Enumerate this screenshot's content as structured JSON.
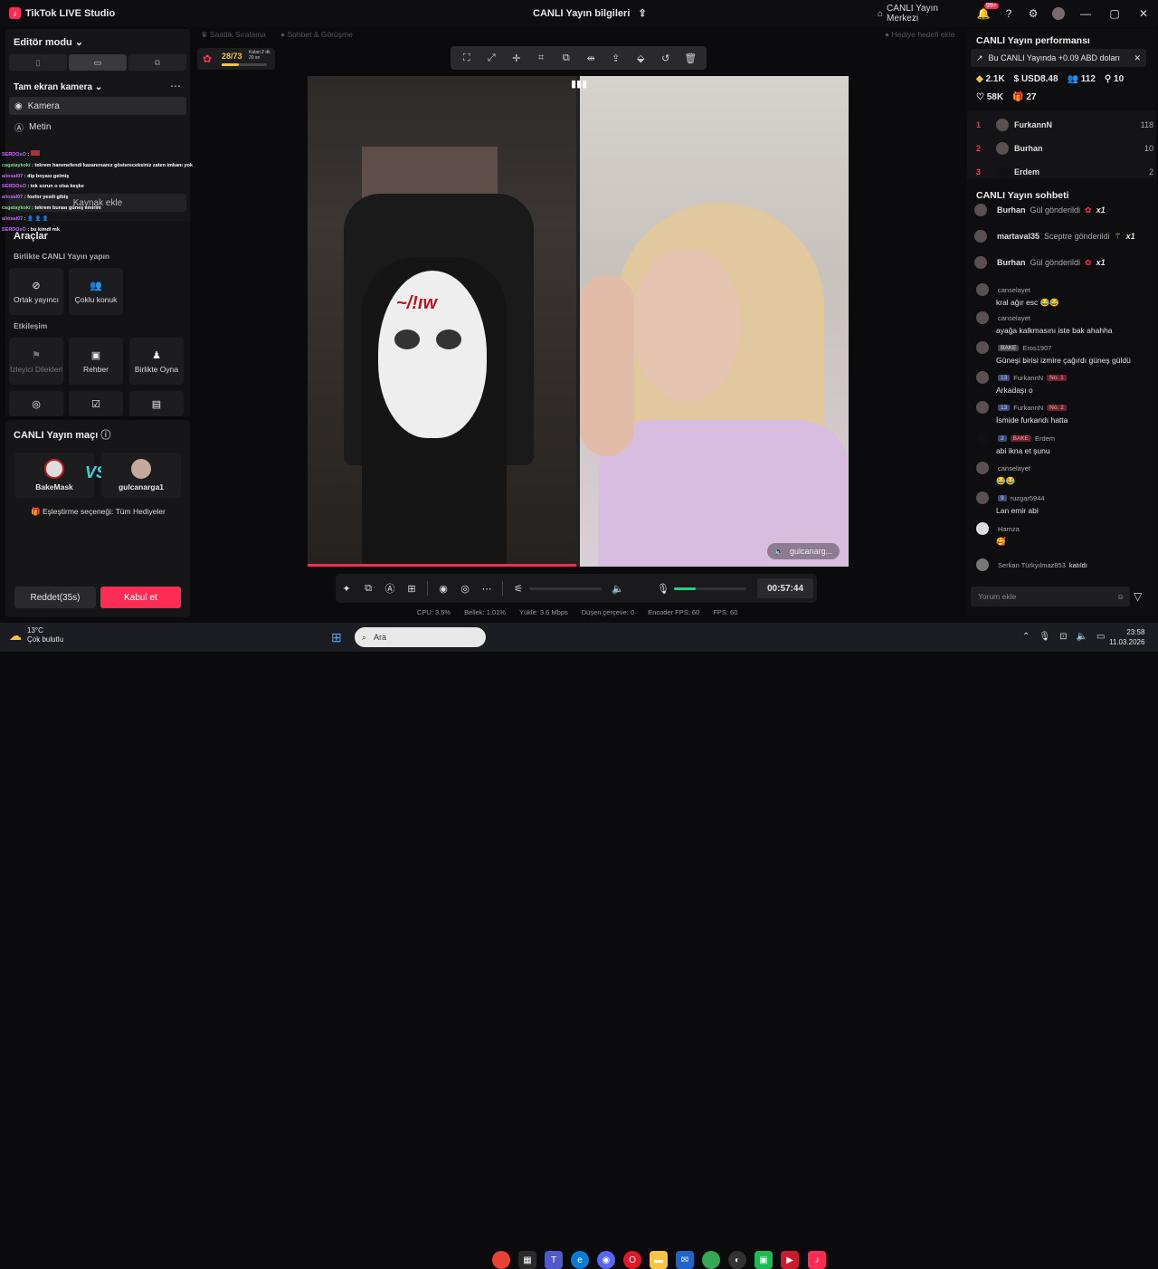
{
  "window": {
    "app_title": "TikTok LIVE Studio",
    "center_title": "CANLI Yayın bilgileri",
    "live_center": "CANLI Yayın Merkezi",
    "notif_count": "99+"
  },
  "left": {
    "editor_mode": "Editör modu",
    "fullscreen_camera": "Tam ekran kamera",
    "sources": [
      {
        "label": "Kamera"
      },
      {
        "label": "Metin"
      }
    ],
    "add_source": "Kaynak ekle",
    "tools_title": "Araçlar",
    "live_together_title": "Birlikte CANLI Yayın yapın",
    "live_together_tools": [
      {
        "label": "Ortak yayıncı"
      },
      {
        "label": "Çoklu konuk"
      }
    ],
    "interaction_title": "Etkileşim",
    "interaction_tools": [
      {
        "label": "İzleyici Dilekleri"
      },
      {
        "label": "Rehber"
      },
      {
        "label": "Birlikte Oyna"
      }
    ],
    "match_title": "CANLI Yayın maçı",
    "player1": "BakeMask",
    "player2": "gulcanarga1",
    "match_option": "Eşleştirme seçeneği: Tüm Hediyeler",
    "decline": "Reddet(35s)",
    "accept": "Kabul et"
  },
  "overlay_chat": [
    {
      "user": "SERDOsO",
      "msg": ""
    },
    {
      "user": "cagataykoki",
      "msg": "tekrem hanımefendi kazanırsanız göstereceksiniz zaten imkanı yok"
    },
    {
      "user": "aliosal07",
      "msg": "dip boyası gelmiş"
    },
    {
      "user": "SERDOsO",
      "msg": "tek sorun o olsa keşke"
    },
    {
      "user": "aliosal07",
      "msg": "fosfor yesili gibiş"
    },
    {
      "user": "cagataykoki",
      "msg": "tekrem burası güneş emirim"
    },
    {
      "user": "aliosal07",
      "msg": ""
    },
    {
      "user": "SERDOsO",
      "msg": "bu kimdi mk"
    }
  ],
  "top_widgets": {
    "left_hint": "Saatlik Sıralama",
    "mid_hint": "Sohbet & Görüşme",
    "right_hint": "Hediye hedefi ekle",
    "goal": "28/73",
    "goal_time": "Kalan 2 dk 20 sn"
  },
  "stage": {
    "guest_label": "gulcanarg..."
  },
  "bottom": {
    "timer": "00:57:44",
    "cpu": "CPU: 3.5%",
    "memory": "Bellek: 1.01%",
    "upload": "Yükle: 3.6 Mbps",
    "dropped": "Düşen çerçeve: 0",
    "encoder_fps": "Encoder FPS: 60",
    "fps": "FPS: 60",
    "mic_level": 0.3
  },
  "right": {
    "perf_title": "CANLI Yayın performansı",
    "perf_banner": "Bu CANLI Yayında +0.09 ABD doları",
    "stats_row1": [
      "2.1K",
      "USD8.48",
      "112",
      "10"
    ],
    "stats_row2": [
      "58K",
      "27"
    ],
    "ranking": [
      {
        "rank": "1",
        "name": "FurkannN",
        "value": "118"
      },
      {
        "rank": "2",
        "name": "Burhan",
        "value": "10"
      },
      {
        "rank": "3",
        "name": "Erdem",
        "value": "2"
      }
    ],
    "chat_title": "CANLI Yayın sohbeti",
    "gifts": [
      {
        "user": "Burhan",
        "text": "Gül gönderildi",
        "count": "x1"
      },
      {
        "user": "martaval35",
        "text": "Sceptre gönderildi",
        "count": "x1"
      },
      {
        "user": "Burhan",
        "text": "Gül gönderildi",
        "count": "x1"
      }
    ],
    "messages": [
      {
        "user": "canselayet",
        "text": "kral ağır esc 😂😂"
      },
      {
        "user": "canselayet",
        "text": "ayağa kalkmasını iste bak ahahha"
      },
      {
        "user": "Eros1907",
        "badge": "BAKE",
        "text": "Güneşi birisi izmire çağırdı güneş güldü"
      },
      {
        "user": "FurkannN",
        "level": "13",
        "rankbadge": "No. 1",
        "text": "Arkadaşı o"
      },
      {
        "user": "FurkannN",
        "level": "13",
        "rankbadge": "No. 2",
        "text": "İsmide furkandı hatta"
      },
      {
        "user": "Erdem",
        "level": "2",
        "badge": "BAKE",
        "text": "abi ikna et şunu"
      },
      {
        "user": "canselayet",
        "text": "😂😂"
      },
      {
        "user": "ruzgar5944",
        "level": "9",
        "text": "Lan emir abi"
      },
      {
        "user": "Hamza",
        "text": "🥰"
      }
    ],
    "join_user": "Serkan Türkyılmaz853",
    "join_text": "katıldı",
    "comment_placeholder": "Yorum ekle"
  },
  "taskbar": {
    "temp": "13°C",
    "weather": "Çok bulutlu",
    "search": "Ara",
    "time": "23:58",
    "date": "11.03.2026"
  }
}
